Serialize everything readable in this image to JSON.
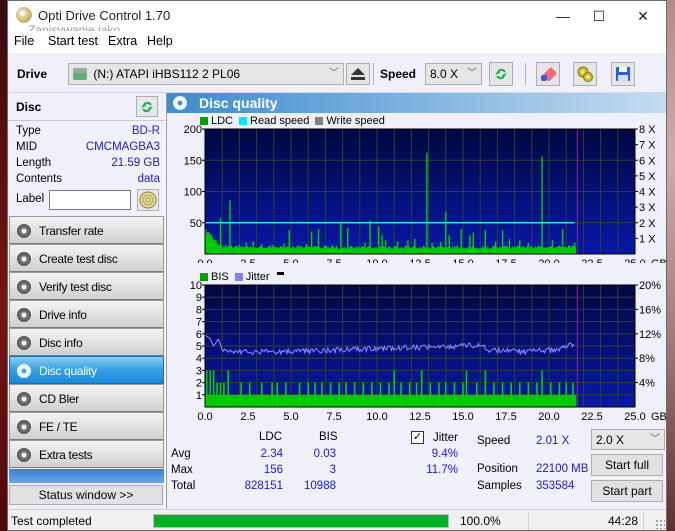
{
  "window": {
    "title": "Opti Drive Control 1.70",
    "ghost_text": "Zapisywanie jako",
    "controls": {
      "minimize": "—",
      "maximize": "☐",
      "close": "✕"
    }
  },
  "menu": [
    "File",
    "Start test",
    "Extra",
    "Help"
  ],
  "toolbar": {
    "drive_label": "Drive",
    "drive_value": "(N:)   ATAPI iHBS112   2 PL06",
    "speed_label": "Speed",
    "speed_value": "8.0 X",
    "icons": [
      "drive-icon",
      "eject-icon",
      "refresh-icon",
      "erase-icon",
      "options-icon",
      "save-icon"
    ]
  },
  "disc": {
    "header": "Disc",
    "fields": [
      {
        "key": "Type",
        "value": "BD-R"
      },
      {
        "key": "MID",
        "value": "CMCMAGBA3"
      },
      {
        "key": "Length",
        "value": "21.59 GB"
      },
      {
        "key": "Contents",
        "value": "data"
      }
    ],
    "label_key": "Label",
    "label_value": ""
  },
  "nav": [
    {
      "label": "Transfer rate",
      "active": false
    },
    {
      "label": "Create test disc",
      "active": false
    },
    {
      "label": "Verify test disc",
      "active": false
    },
    {
      "label": "Drive info",
      "active": false
    },
    {
      "label": "Disc info",
      "active": false
    },
    {
      "label": "Disc quality",
      "active": true
    },
    {
      "label": "CD Bler",
      "active": false
    },
    {
      "label": "FE / TE",
      "active": false
    },
    {
      "label": "Extra tests",
      "active": false
    }
  ],
  "status_window_button": "Status window >>",
  "panel": {
    "title": "Disc quality"
  },
  "chart_data": [
    {
      "type": "bar",
      "title": "LDC",
      "legend": [
        {
          "name": "LDC",
          "color": "#00a000"
        },
        {
          "name": "Read speed",
          "color": "#00e8ff"
        },
        {
          "name": "Write speed",
          "color": "#808080"
        }
      ],
      "legend_placement": "top-left",
      "xlabel": "GB",
      "x_range": [
        0,
        25
      ],
      "x_ticks": [
        "0.0",
        "2.5",
        "5.0",
        "7.5",
        "10.0",
        "12.5",
        "15.0",
        "17.5",
        "20.0",
        "22.5",
        "25.0"
      ],
      "y_left_range": [
        0,
        200
      ],
      "y_left_ticks": [
        "200",
        "150",
        "100",
        "50"
      ],
      "y_right_range": [
        0,
        8
      ],
      "y_right_ticks": [
        "8 X",
        "7 X",
        "6 X",
        "5 X",
        "4 X",
        "3 X",
        "2 X",
        "1 X"
      ],
      "grid": true,
      "end_marker_gb": 21.59,
      "read_speed_x": 2.0,
      "ldc_baseline": 8,
      "ldc_spikes": [
        {
          "x": 0.05,
          "y": 40
        },
        {
          "x": 0.2,
          "y": 35
        },
        {
          "x": 0.4,
          "y": 28
        },
        {
          "x": 0.6,
          "y": 22
        },
        {
          "x": 0.9,
          "y": 58
        },
        {
          "x": 1.2,
          "y": 15
        },
        {
          "x": 1.45,
          "y": 86
        },
        {
          "x": 2.0,
          "y": 15
        },
        {
          "x": 2.4,
          "y": 18
        },
        {
          "x": 2.8,
          "y": 20
        },
        {
          "x": 3.3,
          "y": 16
        },
        {
          "x": 3.9,
          "y": 15
        },
        {
          "x": 4.6,
          "y": 17
        },
        {
          "x": 4.9,
          "y": 38
        },
        {
          "x": 5.4,
          "y": 14
        },
        {
          "x": 5.9,
          "y": 16
        },
        {
          "x": 6.2,
          "y": 36
        },
        {
          "x": 6.6,
          "y": 40
        },
        {
          "x": 7.4,
          "y": 14
        },
        {
          "x": 7.9,
          "y": 50
        },
        {
          "x": 8.3,
          "y": 42
        },
        {
          "x": 8.8,
          "y": 12
        },
        {
          "x": 9.3,
          "y": 18
        },
        {
          "x": 9.6,
          "y": 54
        },
        {
          "x": 10.1,
          "y": 44
        },
        {
          "x": 10.3,
          "y": 30
        },
        {
          "x": 10.5,
          "y": 22
        },
        {
          "x": 11.2,
          "y": 20
        },
        {
          "x": 11.8,
          "y": 22
        },
        {
          "x": 12.2,
          "y": 24
        },
        {
          "x": 12.9,
          "y": 162
        },
        {
          "x": 13.2,
          "y": 18
        },
        {
          "x": 13.7,
          "y": 20
        },
        {
          "x": 14.0,
          "y": 68
        },
        {
          "x": 14.2,
          "y": 30
        },
        {
          "x": 14.9,
          "y": 40
        },
        {
          "x": 15.4,
          "y": 30
        },
        {
          "x": 15.6,
          "y": 34
        },
        {
          "x": 16.3,
          "y": 38
        },
        {
          "x": 16.9,
          "y": 20
        },
        {
          "x": 17.3,
          "y": 38
        },
        {
          "x": 17.7,
          "y": 24
        },
        {
          "x": 18.3,
          "y": 22
        },
        {
          "x": 18.8,
          "y": 18
        },
        {
          "x": 19.6,
          "y": 156
        },
        {
          "x": 20.2,
          "y": 22
        },
        {
          "x": 20.8,
          "y": 40
        },
        {
          "x": 21.2,
          "y": 14
        },
        {
          "x": 21.5,
          "y": 18
        }
      ]
    },
    {
      "type": "bar",
      "title": "BIS",
      "legend": [
        {
          "name": "BIS",
          "color": "#00a000"
        },
        {
          "name": "Jitter",
          "color": "#8080ff"
        }
      ],
      "legend_placement": "top-left",
      "xlabel": "GB",
      "x_range": [
        0,
        25
      ],
      "x_ticks": [
        "0.0",
        "2.5",
        "5.0",
        "7.5",
        "10.0",
        "12.5",
        "15.0",
        "17.5",
        "20.0",
        "22.5",
        "25.0"
      ],
      "y_left_range": [
        0,
        10
      ],
      "y_left_ticks": [
        "10",
        "9",
        "8",
        "7",
        "6",
        "5",
        "4",
        "3",
        "2",
        "1"
      ],
      "y_right_range": [
        0,
        20
      ],
      "y_right_ticks": [
        "20%",
        "16%",
        "12%",
        "8%",
        "4%"
      ],
      "grid": true,
      "end_marker_gb": 21.59,
      "bis_baseline": 1,
      "bis_spikes": [
        {
          "x": 0.1,
          "y": 3
        },
        {
          "x": 0.3,
          "y": 3
        },
        {
          "x": 0.5,
          "y": 3
        },
        {
          "x": 0.7,
          "y": 2
        },
        {
          "x": 0.9,
          "y": 2
        },
        {
          "x": 1.1,
          "y": 2
        },
        {
          "x": 1.35,
          "y": 3
        },
        {
          "x": 2.1,
          "y": 2
        },
        {
          "x": 2.6,
          "y": 2
        },
        {
          "x": 3.3,
          "y": 2
        },
        {
          "x": 3.9,
          "y": 2
        },
        {
          "x": 4.2,
          "y": 2
        },
        {
          "x": 4.7,
          "y": 2
        },
        {
          "x": 5.5,
          "y": 2
        },
        {
          "x": 6.0,
          "y": 2
        },
        {
          "x": 6.4,
          "y": 2
        },
        {
          "x": 6.8,
          "y": 2
        },
        {
          "x": 7.3,
          "y": 2
        },
        {
          "x": 7.8,
          "y": 2
        },
        {
          "x": 8.2,
          "y": 2
        },
        {
          "x": 8.7,
          "y": 2
        },
        {
          "x": 9.2,
          "y": 2
        },
        {
          "x": 9.7,
          "y": 2
        },
        {
          "x": 10.2,
          "y": 2
        },
        {
          "x": 10.7,
          "y": 2
        },
        {
          "x": 11.0,
          "y": 3
        },
        {
          "x": 11.4,
          "y": 2
        },
        {
          "x": 11.9,
          "y": 2
        },
        {
          "x": 12.3,
          "y": 2
        },
        {
          "x": 12.6,
          "y": 3
        },
        {
          "x": 13.1,
          "y": 2
        },
        {
          "x": 13.6,
          "y": 2
        },
        {
          "x": 14.0,
          "y": 2
        },
        {
          "x": 14.5,
          "y": 2
        },
        {
          "x": 15.0,
          "y": 2
        },
        {
          "x": 15.2,
          "y": 3
        },
        {
          "x": 15.8,
          "y": 2
        },
        {
          "x": 16.3,
          "y": 3
        },
        {
          "x": 16.8,
          "y": 2
        },
        {
          "x": 17.3,
          "y": 2
        },
        {
          "x": 17.8,
          "y": 2
        },
        {
          "x": 18.3,
          "y": 2
        },
        {
          "x": 18.8,
          "y": 2
        },
        {
          "x": 19.3,
          "y": 2
        },
        {
          "x": 19.6,
          "y": 3
        },
        {
          "x": 20.1,
          "y": 2
        },
        {
          "x": 20.6,
          "y": 2
        },
        {
          "x": 21.0,
          "y": 2
        },
        {
          "x": 21.4,
          "y": 2
        }
      ],
      "jitter_pct": [
        {
          "x": 0.0,
          "y": 11.8
        },
        {
          "x": 0.3,
          "y": 11.2
        },
        {
          "x": 0.5,
          "y": 10.0
        },
        {
          "x": 0.8,
          "y": 11.2
        },
        {
          "x": 1.0,
          "y": 9.2
        },
        {
          "x": 2.5,
          "y": 9.0
        },
        {
          "x": 5.0,
          "y": 9.1
        },
        {
          "x": 7.5,
          "y": 9.3
        },
        {
          "x": 10.0,
          "y": 9.6
        },
        {
          "x": 12.5,
          "y": 9.8
        },
        {
          "x": 14.0,
          "y": 9.9
        },
        {
          "x": 16.0,
          "y": 10.2
        },
        {
          "x": 16.5,
          "y": 9.4
        },
        {
          "x": 18.5,
          "y": 9.0
        },
        {
          "x": 20.5,
          "y": 9.5
        },
        {
          "x": 21.4,
          "y": 10.4
        },
        {
          "x": 21.55,
          "y": 9.6
        }
      ]
    }
  ],
  "stats": {
    "col_ldc": "LDC",
    "col_bis": "BIS",
    "jitter_label": "Jitter",
    "jitter_checked": true,
    "rows": [
      {
        "label": "Avg",
        "ldc": "2.34",
        "bis": "0.03",
        "jitter": "9.4%"
      },
      {
        "label": "Max",
        "ldc": "156",
        "bis": "3",
        "jitter": "11.7%"
      },
      {
        "label": "Total",
        "ldc": "828151",
        "bis": "10988",
        "jitter": ""
      }
    ],
    "speed_label": "Speed",
    "speed_value": "2.01 X",
    "position_label": "Position",
    "position_value": "22100 MB",
    "samples_label": "Samples",
    "samples_value": "353584",
    "speed_select": "2.0 X",
    "start_full": "Start full",
    "start_part": "Start part"
  },
  "statusbar": {
    "text": "Test completed",
    "progress": 100.0,
    "progress_text": "100.0%",
    "elapsed": "44:28"
  }
}
